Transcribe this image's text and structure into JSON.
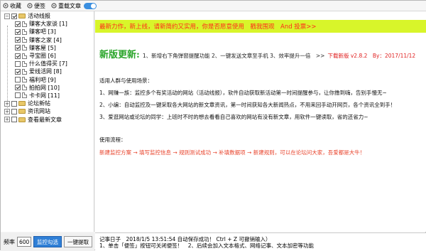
{
  "toolbar": {
    "collapse_label": "收藏",
    "sticky_label": "便签",
    "repeat_label": "重载文章",
    "repeat_enabled": true
  },
  "tree": {
    "root_label": "活动线报",
    "items": [
      {
        "label": "赚客大家谈 [1]",
        "checked": true
      },
      {
        "label": "赚客吧 [3]",
        "checked": true
      },
      {
        "label": "赚客之家 [4]",
        "checked": true
      },
      {
        "label": "赚客屋 [5]",
        "checked": true
      },
      {
        "label": "寻宝圈 [6]",
        "checked": true
      },
      {
        "label": "什么值得买 [7]",
        "checked": false
      },
      {
        "label": "爱线活网 [8]",
        "checked": true
      },
      {
        "label": "福利吧 [9]",
        "checked": false
      },
      {
        "label": "拍拍网 [10]",
        "checked": true
      },
      {
        "label": "卡卡网 [11]",
        "checked": false
      }
    ],
    "groups": [
      {
        "label": "论坛新帖"
      },
      {
        "label": "资讯网站"
      },
      {
        "label": "查看最新文章"
      }
    ]
  },
  "bottom": {
    "freq_label": "频率",
    "freq_value": "600",
    "monitor_button": "监控勾选",
    "fetch_button": "一键提取"
  },
  "content": {
    "banner": "最新力作，新上线，请新简约又实用，你是否愿意使用　戳我围观　And 投票>>",
    "version_title": "新版更新:",
    "version_desc": "1、新增右下角弹窗提醒功能 2、一键发送文章至手机 3、效率提升一倍　>>",
    "version_tag": "下载新版 v2.8.2　By：2017/11/12",
    "audience_title": "适用人群与使用场景：",
    "audience_1": "1、网赚一族：监控多个有奖活动的网站（活动线报），软件自动获取新活动第一时间提醒参与，让你撸到嗨，告别手慢无~",
    "audience_2": "2、小编：自动监控及一键采取各大网站的新文章资讯，第一时间获知各大新闻热点，不用来回手动开网页，各个资讯全到手！",
    "audience_3": "3、爱逛网站或论坛的同学：上班时不时的想去看看自己喜欢的网站有没有新文章，用软件一键读取，省的还省力~",
    "flow_title": "使用流程：",
    "flow_text": "新建监控方案 → 填写监控信息 → 规则测试成功 → 补填数据项 → 新建规则，可以在论坛问大家，吾爱都是大牛！"
  },
  "log": {
    "line1": "记事日子　2018/1/5 13:51:54 自动保存成功！ Ctrl + Z 可撤销输入）",
    "line2": "1、单击「便签」按钮可关闭便签！　2、后续会加入文本格式、网络记事、文本加密等功能"
  }
}
